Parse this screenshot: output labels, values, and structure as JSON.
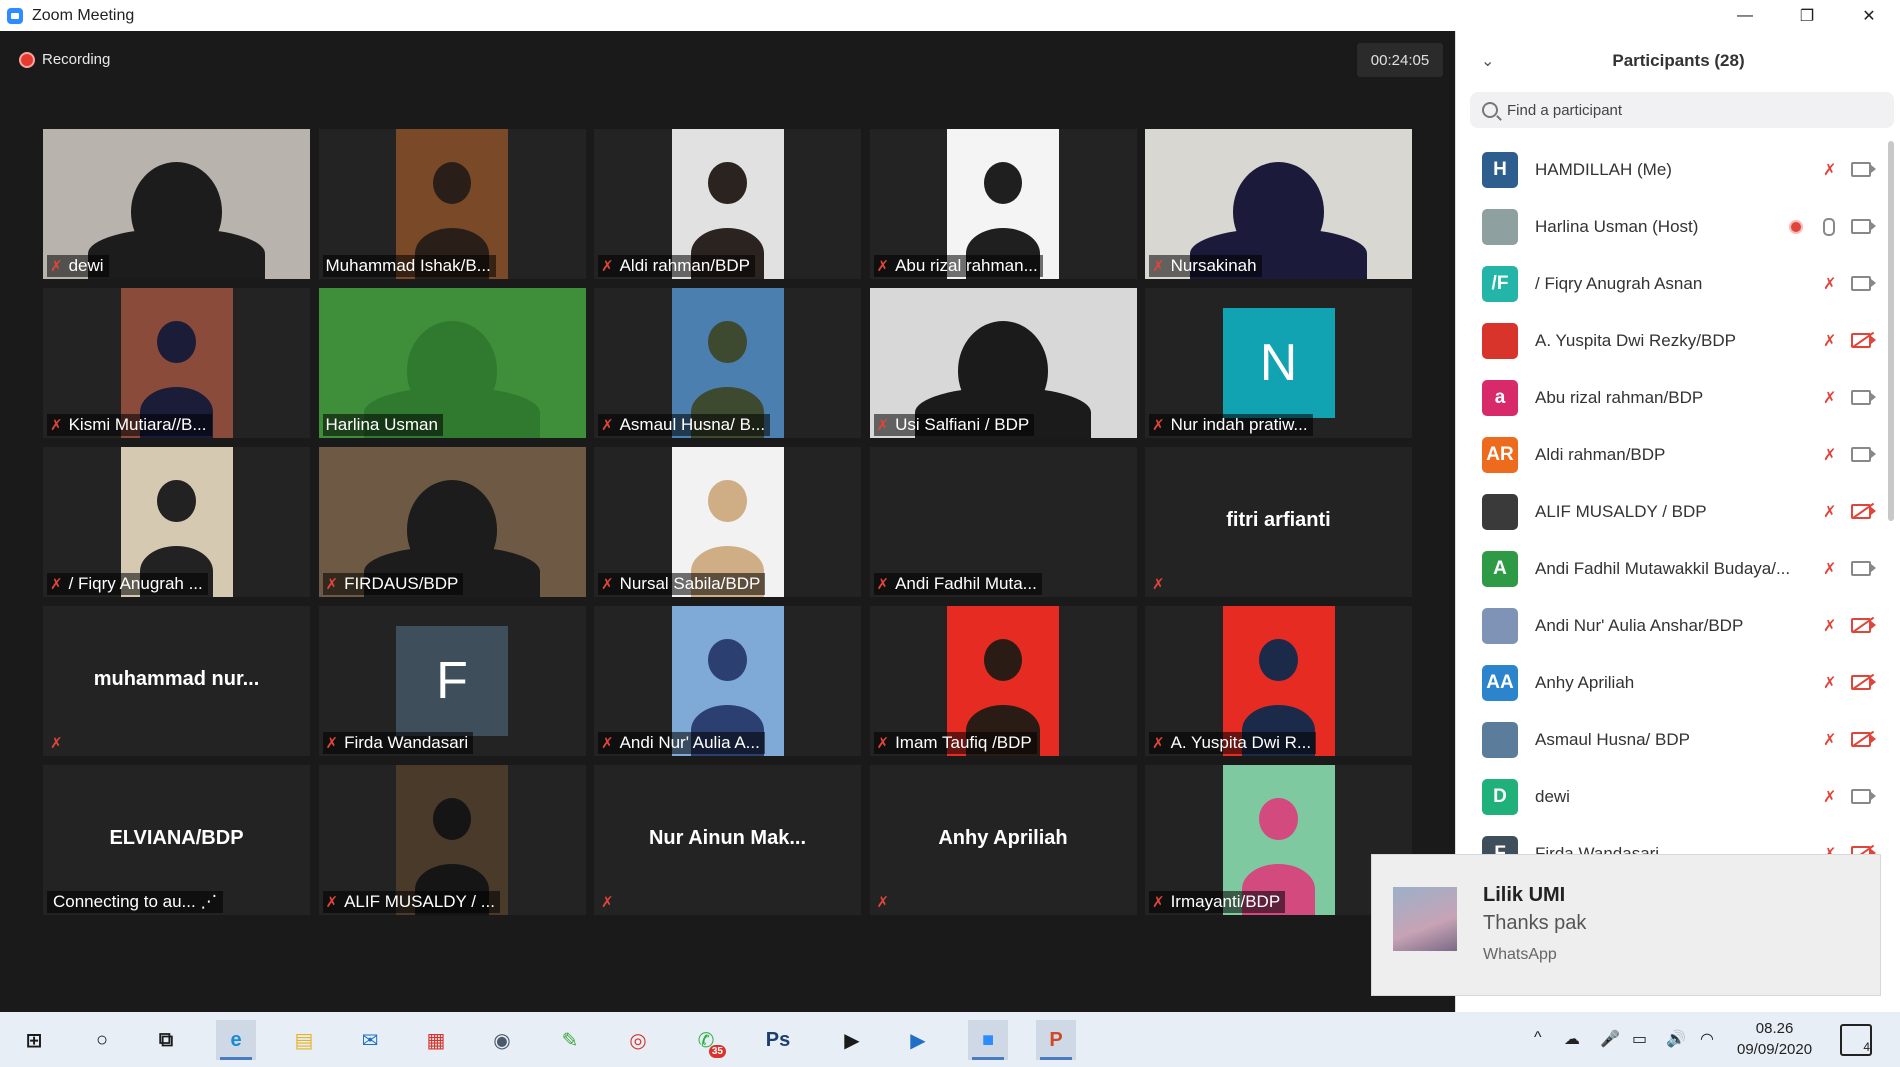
{
  "window": {
    "title": "Zoom Meeting",
    "controls": [
      "—",
      "❐",
      "✕"
    ]
  },
  "meeting": {
    "recording_label": "Recording",
    "timer": "00:24:05"
  },
  "tiles": [
    {
      "name": "dewi",
      "kind": "video",
      "bg": "#b9b3ae",
      "fg": "#1c1c1c",
      "muted": true
    },
    {
      "name": "Muhammad Ishak/B...",
      "kind": "video-small",
      "bg": "#7a4a28",
      "fg": "#2a1f18",
      "muted": false
    },
    {
      "name": "Aldi rahman/BDP",
      "kind": "video-small",
      "bg": "#e1e1e1",
      "fg": "#2b2320",
      "muted": true
    },
    {
      "name": "Abu rizal rahman...",
      "kind": "video-small",
      "bg": "#f4f4f4",
      "fg": "#1f1f1f",
      "muted": true
    },
    {
      "name": "Nursakinah",
      "kind": "video",
      "bg": "#d9d7d2",
      "fg": "#1c1a3a",
      "muted": true
    },
    {
      "name": "Kismi Mutiara//B...",
      "kind": "video-small",
      "bg": "#8a4b3a",
      "fg": "#1a1c38",
      "muted": true
    },
    {
      "name": "Harlina Usman",
      "kind": "video",
      "bg": "#3f8f3a",
      "fg": "#2f7a2f",
      "muted": false
    },
    {
      "name": "Asmaul Husna/ B...",
      "kind": "video-small",
      "bg": "#4a7fb0",
      "fg": "#3e4a2f",
      "muted": true
    },
    {
      "name": "Usi Salfiani / BDP",
      "kind": "video",
      "bg": "#d8d8d8",
      "fg": "#1b1b1b",
      "muted": true
    },
    {
      "name": "Nur indah pratiw...",
      "kind": "letter",
      "letter": "N",
      "bg": "#11a3b1",
      "muted": true
    },
    {
      "name": "/ Fiqry Anugrah ...",
      "kind": "video-small",
      "bg": "#d6c9b2",
      "fg": "#222222",
      "muted": true
    },
    {
      "name": "FIRDAUS/BDP",
      "kind": "video",
      "bg": "#6e5a44",
      "fg": "#1c1c1c",
      "muted": true
    },
    {
      "name": "Nursal Sabila/BDP",
      "kind": "video-small",
      "bg": "#f2f2f2",
      "fg": "#cfae86",
      "muted": true
    },
    {
      "name": "Andi Fadhil Muta...",
      "kind": "blank",
      "muted": true
    },
    {
      "name": "fitri arfianti",
      "kind": "nameonly",
      "muted": true
    },
    {
      "name": "muhammad  nur...",
      "kind": "nameonly",
      "muted": true
    },
    {
      "name": "Firda Wandasari",
      "kind": "letter",
      "letter": "F",
      "bg": "#3e4e5a",
      "muted": true
    },
    {
      "name": "Andi Nur' Aulia A...",
      "kind": "video-small",
      "bg": "#7fa9d6",
      "fg": "#2b3f70",
      "muted": true
    },
    {
      "name": "Imam Taufiq /BDP",
      "kind": "video-small",
      "bg": "#e52b22",
      "fg": "#2a1c14",
      "muted": true
    },
    {
      "name": "A. Yuspita Dwi R...",
      "kind": "video-small",
      "bg": "#e52b22",
      "fg": "#1c2a4a",
      "muted": true
    },
    {
      "name": "ELVIANA/BDP",
      "kind": "connecting",
      "status": "Connecting to au...",
      "muted": false
    },
    {
      "name": "ALIF MUSALDY / ...",
      "kind": "video-small",
      "bg": "#4a3a2a",
      "fg": "#151515",
      "muted": true
    },
    {
      "name": "Nur  Ainun  Mak...",
      "kind": "nameonly",
      "muted": true
    },
    {
      "name": "Anhy Apriliah",
      "kind": "nameonly",
      "muted": true
    },
    {
      "name": "Irmayanti/BDP",
      "kind": "video-small",
      "bg": "#7ec9a0",
      "fg": "#d24a7e",
      "muted": true
    }
  ],
  "participants_panel": {
    "title": "Participants (28)",
    "search_placeholder": "Find a participant",
    "participants": [
      {
        "name": "HAMDILLAH (Me)",
        "avatar": "H",
        "color": "#2e5e8e",
        "mic": "muted",
        "cam": "on",
        "rec": false
      },
      {
        "name": "Harlina Usman (Host)",
        "avatar": "",
        "color": "#8fa0a0",
        "mic": "on",
        "cam": "on",
        "rec": true
      },
      {
        "name": "/ Fiqry Anugrah Asnan",
        "avatar": "/F",
        "color": "#22b5a8",
        "mic": "muted",
        "cam": "on",
        "rec": false
      },
      {
        "name": "A. Yuspita Dwi Rezky/BDP",
        "avatar": "",
        "color": "#d8342c",
        "mic": "muted",
        "cam": "off",
        "rec": false
      },
      {
        "name": "Abu rizal rahman/BDP",
        "avatar": "a",
        "color": "#d82a6a",
        "mic": "muted",
        "cam": "on",
        "rec": false
      },
      {
        "name": "Aldi rahman/BDP",
        "avatar": "AR",
        "color": "#ee6a1c",
        "mic": "muted",
        "cam": "on",
        "rec": false
      },
      {
        "name": "ALIF MUSALDY / BDP",
        "avatar": "",
        "color": "#3a3a3a",
        "mic": "muted",
        "cam": "off",
        "rec": false
      },
      {
        "name": "Andi Fadhil Mutawakkil Budaya/...",
        "avatar": "A",
        "color": "#2f9a46",
        "mic": "muted",
        "cam": "on",
        "rec": false
      },
      {
        "name": "Andi Nur' Aulia Anshar/BDP",
        "avatar": "",
        "color": "#7e93b5",
        "mic": "muted",
        "cam": "off",
        "rec": false
      },
      {
        "name": "Anhy Apriliah",
        "avatar": "AA",
        "color": "#2b84cc",
        "mic": "muted",
        "cam": "off",
        "rec": false
      },
      {
        "name": "Asmaul Husna/ BDP",
        "avatar": "",
        "color": "#5b7c9a",
        "mic": "muted",
        "cam": "off",
        "rec": false
      },
      {
        "name": "dewi",
        "avatar": "D",
        "color": "#20b07a",
        "mic": "muted",
        "cam": "on",
        "rec": false
      },
      {
        "name": "Firda Wandasari",
        "avatar": "F",
        "color": "#3e4e5a",
        "mic": "muted",
        "cam": "off",
        "rec": false
      }
    ]
  },
  "notification": {
    "title": "Lilik UMI",
    "message": "Thanks pak",
    "app": "WhatsApp"
  },
  "taskbar": {
    "apps": [
      {
        "name": "start-icon",
        "glyph": "⊞",
        "color": "#1a1a1a",
        "active": false
      },
      {
        "name": "search-icon",
        "glyph": "○",
        "color": "#1a1a1a",
        "active": false
      },
      {
        "name": "task-view-icon",
        "glyph": "⧉",
        "color": "#1a1a1a",
        "active": false
      },
      {
        "name": "edge-icon",
        "glyph": "e",
        "color": "#1b8ad6",
        "active": true
      },
      {
        "name": "file-explorer-icon",
        "glyph": "▤",
        "color": "#e6b325",
        "active": false
      },
      {
        "name": "mail-icon",
        "glyph": "✉",
        "color": "#1f6fc5",
        "active": false
      },
      {
        "name": "gift-icon",
        "glyph": "▦",
        "color": "#d8342c",
        "active": false
      },
      {
        "name": "camera-icon",
        "glyph": "◉",
        "color": "#4a5a6a",
        "active": false
      },
      {
        "name": "coreldraw-icon",
        "glyph": "✎",
        "color": "#3aa63a",
        "active": false
      },
      {
        "name": "chrome-icon",
        "glyph": "◎",
        "color": "#d8342c",
        "active": false
      },
      {
        "name": "whatsapp-icon",
        "glyph": "✆",
        "color": "#25b13e",
        "active": false,
        "badge": "35"
      },
      {
        "name": "photoshop-icon",
        "glyph": "Ps",
        "color": "#1e3e6e",
        "active": false
      },
      {
        "name": "app-icon",
        "glyph": "▶",
        "color": "#1a1a1a",
        "active": false
      },
      {
        "name": "video-player-icon",
        "glyph": "▶",
        "color": "#1f6fc5",
        "active": false
      },
      {
        "name": "zoom-icon",
        "glyph": "■",
        "color": "#2D8CFF",
        "active": true
      },
      {
        "name": "powerpoint-icon",
        "glyph": "P",
        "color": "#d24726",
        "active": true
      }
    ],
    "tray_icons": [
      "^",
      "☁",
      "🎤",
      "▭",
      "🔊",
      "◠"
    ],
    "time": "08.26",
    "date": "09/09/2020",
    "notification_count": "4"
  }
}
